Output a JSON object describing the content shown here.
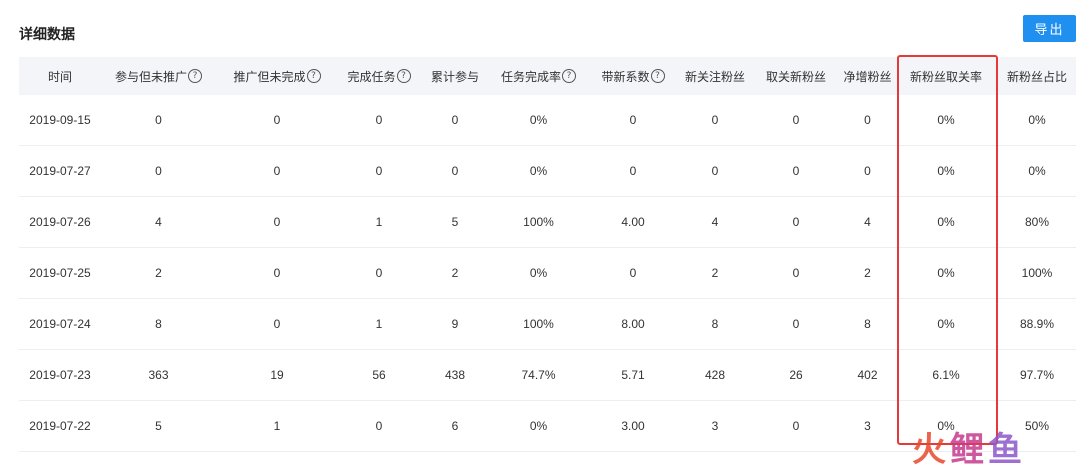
{
  "page_title": "详细数据",
  "export_label": "导出",
  "help_glyph": "?",
  "columns": [
    {
      "label": "时间",
      "help": false
    },
    {
      "label": "参与但未推广",
      "help": true
    },
    {
      "label": "推广但未完成",
      "help": true
    },
    {
      "label": "完成任务",
      "help": true
    },
    {
      "label": "累计参与",
      "help": false
    },
    {
      "label": "任务完成率",
      "help": true
    },
    {
      "label": "带新系数",
      "help": true
    },
    {
      "label": "新关注粉丝",
      "help": false
    },
    {
      "label": "取关新粉丝",
      "help": false
    },
    {
      "label": "净增粉丝",
      "help": false
    },
    {
      "label": "新粉丝取关率",
      "help": false
    },
    {
      "label": "新粉丝占比",
      "help": false
    }
  ],
  "rows": [
    [
      "2019-09-15",
      "0",
      "0",
      "0",
      "0",
      "0%",
      "0",
      "0",
      "0",
      "0",
      "0%",
      "0%"
    ],
    [
      "2019-07-27",
      "0",
      "0",
      "0",
      "0",
      "0%",
      "0",
      "0",
      "0",
      "0",
      "0%",
      "0%"
    ],
    [
      "2019-07-26",
      "4",
      "0",
      "1",
      "5",
      "100%",
      "4.00",
      "4",
      "0",
      "4",
      "0%",
      "80%"
    ],
    [
      "2019-07-25",
      "2",
      "0",
      "0",
      "2",
      "0%",
      "0",
      "2",
      "0",
      "2",
      "0%",
      "100%"
    ],
    [
      "2019-07-24",
      "8",
      "0",
      "1",
      "9",
      "100%",
      "8.00",
      "8",
      "0",
      "8",
      "0%",
      "88.9%"
    ],
    [
      "2019-07-23",
      "363",
      "19",
      "56",
      "438",
      "74.7%",
      "5.71",
      "428",
      "26",
      "402",
      "6.1%",
      "97.7%"
    ],
    [
      "2019-07-22",
      "5",
      "1",
      "0",
      "6",
      "0%",
      "3.00",
      "3",
      "0",
      "3",
      "0%",
      "50%"
    ]
  ],
  "watermark": {
    "chars": [
      "火",
      "鲤",
      "鱼"
    ]
  },
  "colors": {
    "accent": "#1f8ff0",
    "highlight": "#e63a3a",
    "header_bg": "#f3f5f8"
  }
}
